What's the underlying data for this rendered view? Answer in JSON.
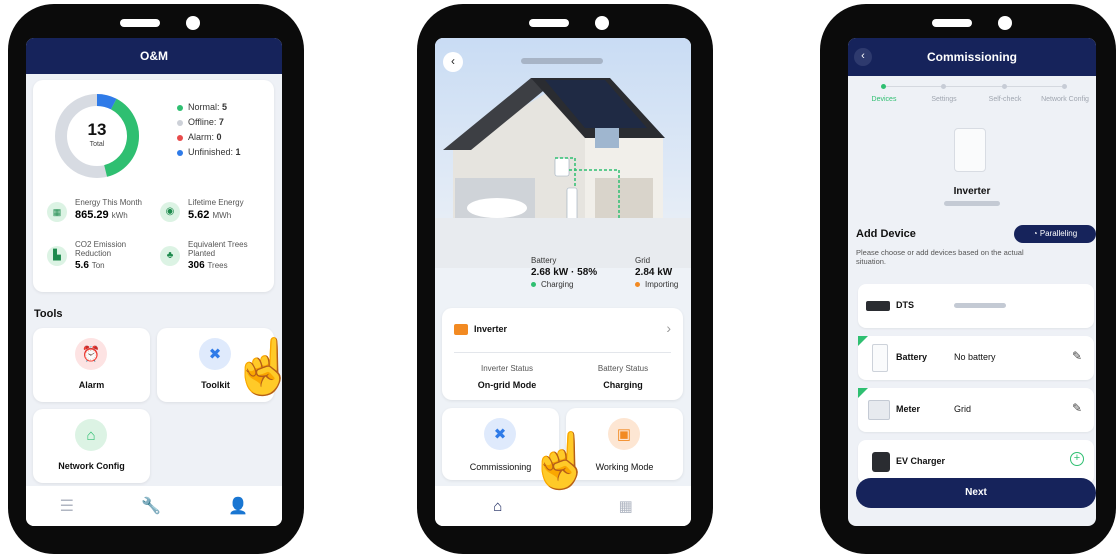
{
  "phone1": {
    "title": "O&M",
    "donut": {
      "total": "13",
      "total_label": "Total",
      "normal": 5,
      "offline": 7,
      "alarm": 0,
      "unfinished": 1
    },
    "legend": [
      {
        "label": "Normal:",
        "value": "5",
        "color": "#2fbf71"
      },
      {
        "label": "Offline:",
        "value": "7",
        "color": "#cdd1d8"
      },
      {
        "label": "Alarm:",
        "value": "0",
        "color": "#e84b4b"
      },
      {
        "label": "Unfinished:",
        "value": "1",
        "color": "#2f7be8"
      }
    ],
    "stats": [
      {
        "label": "Energy This Month",
        "value": "865.29",
        "unit": "kWh",
        "icon": "calendar-icon"
      },
      {
        "label": "Lifetime Energy",
        "value": "5.62",
        "unit": "MWh",
        "icon": "energy-icon"
      },
      {
        "label": "CO2 Emission Reduction",
        "value": "5.6",
        "unit": "Ton",
        "icon": "factory-icon"
      },
      {
        "label": "Equivalent Trees Planted",
        "value": "306",
        "unit": "Trees",
        "icon": "tree-icon"
      }
    ],
    "tools_title": "Tools",
    "tools": [
      {
        "label": "Alarm",
        "icon": "alarm-icon"
      },
      {
        "label": "Toolkit",
        "icon": "wrench-icon"
      },
      {
        "label": "Network Config",
        "icon": "router-icon"
      }
    ]
  },
  "phone2": {
    "battery": {
      "title": "Battery",
      "value": "2.68 kW · 58%",
      "status": "Charging"
    },
    "grid": {
      "title": "Grid",
      "value": "2.84 kW",
      "status": "Importing"
    },
    "inverter_title": "Inverter",
    "inverter_status_label": "Inverter Status",
    "inverter_status_value": "On-grid Mode",
    "battery_status_label": "Battery Status",
    "battery_status_value": "Charging",
    "actions": [
      {
        "label": "Commissioning",
        "icon": "wrench-icon"
      },
      {
        "label": "Working Mode",
        "icon": "mode-icon"
      }
    ]
  },
  "phone3": {
    "title": "Commissioning",
    "steps": [
      "Devices",
      "Settings",
      "Self-check",
      "Network Config"
    ],
    "device_name": "Inverter",
    "add_device_title": "Add Device",
    "paralleling_label": "Paralleling",
    "hint": "Please choose or add devices based on the actual situation.",
    "devices": [
      {
        "name": "DTS",
        "value": ""
      },
      {
        "name": "Battery",
        "value": "No battery"
      },
      {
        "name": "Meter",
        "value": "Grid"
      },
      {
        "name": "EV Charger",
        "value": ""
      }
    ],
    "next_label": "Next"
  },
  "colors": {
    "navy": "#16235b",
    "green": "#2fbf71",
    "orange": "#f28a22",
    "blue": "#2f7be8"
  }
}
